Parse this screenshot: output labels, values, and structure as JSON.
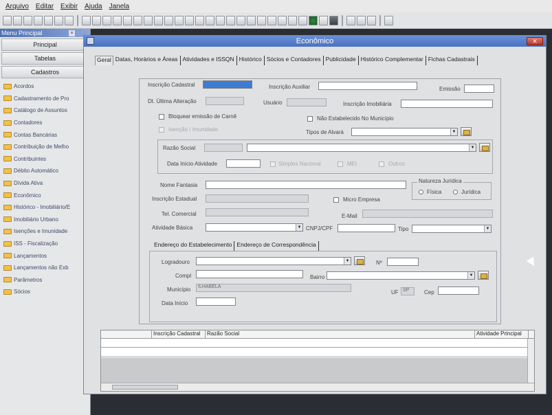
{
  "menu": [
    "Arquivo",
    "Editar",
    "Exibir",
    "Ajuda",
    "Janela"
  ],
  "sidebar": {
    "title": "Menu Principal",
    "close": "×",
    "buttons": [
      "Principal",
      "Tabelas",
      "Cadastros"
    ],
    "items": [
      "Acordos",
      "Cadastramento de Pro",
      "Catálogo de Assuntos",
      "Contadores",
      "Contas Bancárias",
      "Contribuição de Melho",
      "Contribuintes",
      "Débito Automático",
      "Dívida Ativa",
      "Econômico",
      "Histórico - Imobiliário/E",
      "Imobiliário Urbano",
      "Isenções e Imunidade",
      "ISS - Fiscalização",
      "Lançamentos",
      "Lançamentos não Exb",
      "Parâmetros",
      "Sócios"
    ]
  },
  "window": {
    "title": "Econômico",
    "close": "✕",
    "tabs": [
      "Geral",
      "Datas, Horários e Áreas",
      "Atividades e ISSQN",
      "Histórico",
      "Sócios e Contadores",
      "Publicidade",
      "Histórico Complementar",
      "Fichas Cadastrais"
    ],
    "labels": {
      "inscricao_cadastral": "Inscrição Cadastral",
      "inscricao_auxiliar": "Inscrição Auxiliar",
      "emissao": "Emissão",
      "dt_ultima_alteracao": "Dt. Última Alteração",
      "usuario": "Usuário",
      "inscricao_imobiliaria": "Inscrição Imobiliária",
      "bloquear_carne": "Bloquear emissão de Carnê",
      "nao_estabelecido": "Não Estabelecido No Município",
      "isencao": "Isenção / Imunidade",
      "tipos_alvara": "Tipos de Alvará",
      "razao_social": "Razão Social",
      "data_inicio_atividade": "Data Início Atividade",
      "simples_nacional": "Simples Nacional",
      "mei": "MEI",
      "outros": "Outros",
      "nome_fantasia": "Nome Fantasia",
      "natureza_juridica": "Natureza Jurídica",
      "fisica": "Física",
      "juridica": "Jurídica",
      "inscricao_estadual": "Inscrição Estadual",
      "micro_empresa": "Micro Empresa",
      "tel_comercial": "Tel. Comercial",
      "email": "E-Mail",
      "atividade_basica": "Atividade Básica",
      "cnpj_cpf": "CNPJ/CPF",
      "tipo": "Tipo"
    },
    "address_tabs": [
      "Endereço do Estabelecimento",
      "Endereço de Correspondência"
    ],
    "address": {
      "logradouro": "Logradouro",
      "numero": "Nº",
      "compl": "Compl",
      "bairro": "Bairro",
      "municipio": "Município",
      "municipio_value": "ILHABELA",
      "uf": "UF",
      "uf_value": "SP",
      "cep": "Cep",
      "data_inicio": "Data Início"
    },
    "grid_columns": [
      "Inscrição Cadastral",
      "Razão Social",
      "Atividade Principal"
    ]
  }
}
